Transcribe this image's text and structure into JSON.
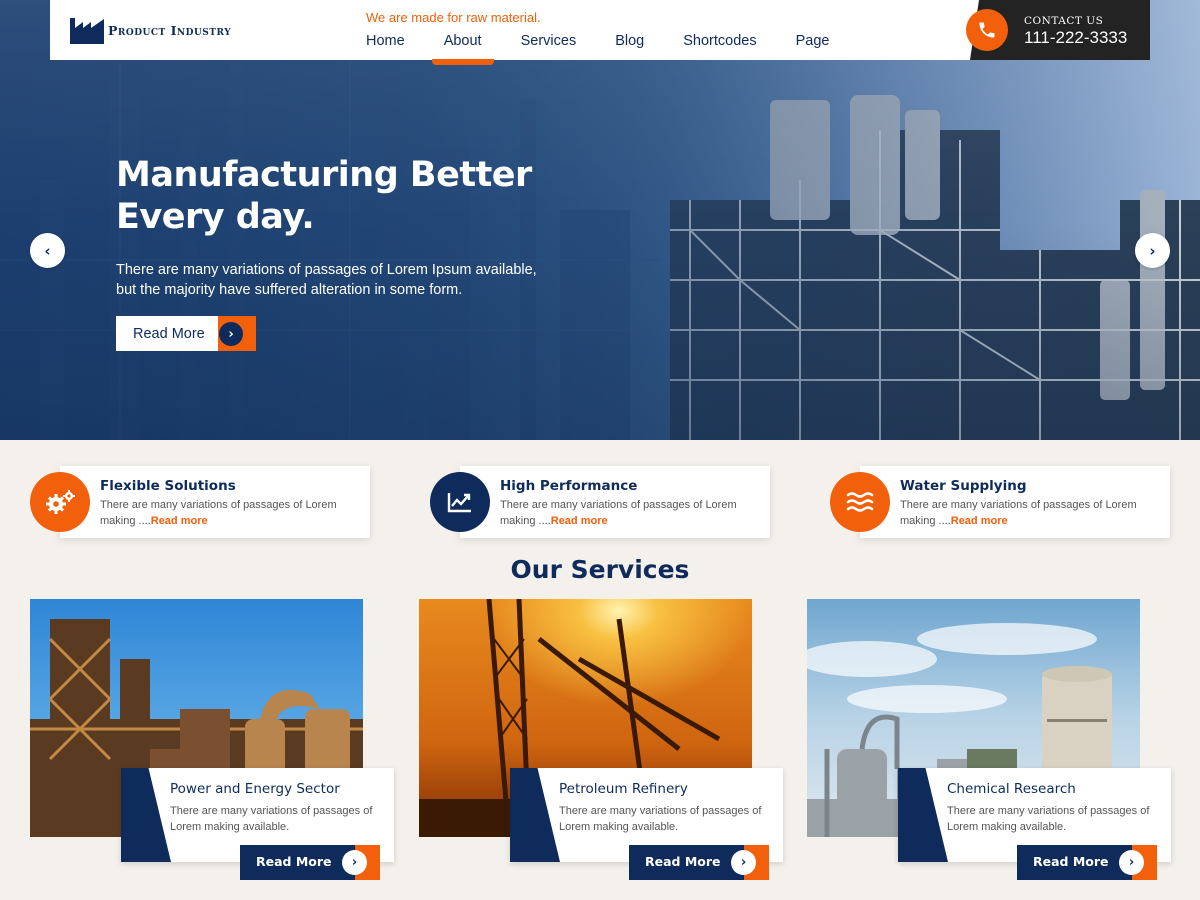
{
  "header": {
    "logo_text": "Product Industry",
    "tagline": "We are made for raw material.",
    "nav": [
      {
        "label": "Home"
      },
      {
        "label": "About"
      },
      {
        "label": "Services"
      },
      {
        "label": "Blog"
      },
      {
        "label": "Shortcodes"
      },
      {
        "label": "Page"
      }
    ],
    "contact_label": "CONTACT US",
    "contact_phone": "111-222-3333"
  },
  "hero": {
    "title": "Manufacturing Better Every day.",
    "text": "There are many variations of passages of Lorem Ipsum available, but the majority have suffered alteration in some form.",
    "button_label": "Read More"
  },
  "features": [
    {
      "title": "Flexible Solutions",
      "text": "There are many variations of passages of Lorem making ....",
      "link": "Read more",
      "icon": "gears-icon"
    },
    {
      "title": "High Performance",
      "text": "There are many variations of passages of Lorem making ....",
      "link": "Read more",
      "icon": "chart-line-icon"
    },
    {
      "title": "Water Supplying",
      "text": "There are many variations of passages of Lorem making ....",
      "link": "Read more",
      "icon": "water-waves-icon"
    }
  ],
  "services_title": "Our Services",
  "services": [
    {
      "title": "Power and Energy Sector",
      "text": "There are many variations of passages of Lorem making available.",
      "button_label": "Read More"
    },
    {
      "title": "Petroleum Refinery",
      "text": "There are many variations of passages of Lorem making available.",
      "button_label": "Read More"
    },
    {
      "title": "Chemical Research",
      "text": "There are many variations of passages of Lorem making available.",
      "button_label": "Read More"
    }
  ],
  "colors": {
    "navy": "#0f2b5b",
    "orange": "#f2600c",
    "background": "#f4f1ec"
  }
}
